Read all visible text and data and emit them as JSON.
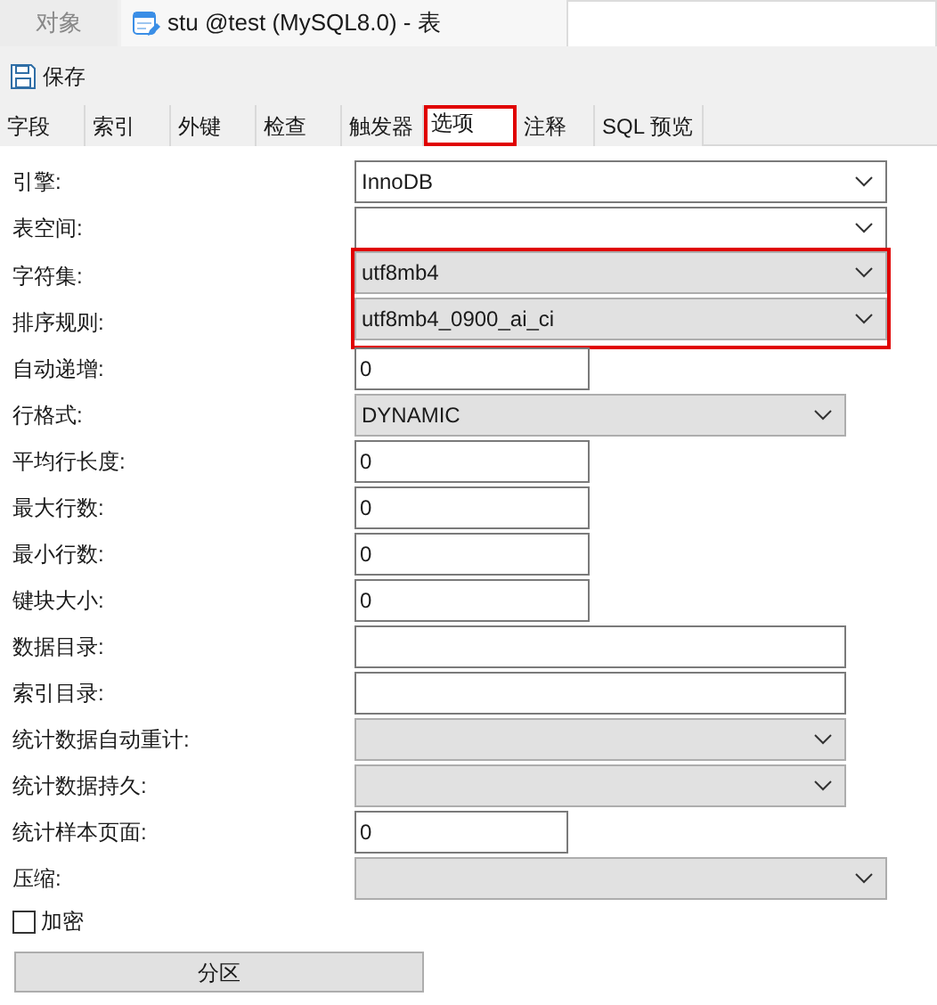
{
  "doc_tabs": [
    {
      "label": "对象",
      "selected": false,
      "icon": false
    },
    {
      "label": "stu @test (MySQL8.0) - 表",
      "selected": true,
      "icon": true
    }
  ],
  "toolbar": {
    "save": "保存"
  },
  "tabs": [
    {
      "label": "字段",
      "selected": false,
      "highlighted": false
    },
    {
      "label": "索引",
      "selected": false,
      "highlighted": false
    },
    {
      "label": "外键",
      "selected": false,
      "highlighted": false
    },
    {
      "label": "检查",
      "selected": false,
      "highlighted": false
    },
    {
      "label": "触发器",
      "selected": false,
      "highlighted": false
    },
    {
      "label": "选项",
      "selected": true,
      "highlighted": true
    },
    {
      "label": "注释",
      "selected": false,
      "highlighted": false
    },
    {
      "label": "SQL 预览",
      "selected": false,
      "highlighted": false
    }
  ],
  "fields": [
    {
      "label": "引擎:",
      "kind": "combo",
      "value": "InnoDB",
      "highlighted": false
    },
    {
      "label": "表空间:",
      "kind": "combo",
      "highlighted": false
    },
    {
      "label": "字符集:",
      "kind": "dropdown",
      "value": "utf8mb4",
      "highlighted": true
    },
    {
      "label": "排序规则:",
      "kind": "dropdown",
      "value": "utf8mb4_0900_ai_ci",
      "highlighted": true
    },
    {
      "label": "自动递增:",
      "kind": "text",
      "value": "0",
      "highlighted": false
    },
    {
      "label": "行格式:",
      "kind": "dropdown",
      "value": "DYNAMIC",
      "highlighted": false
    },
    {
      "label": "平均行长度:",
      "kind": "text",
      "value": "0",
      "highlighted": false
    },
    {
      "label": "最大行数:",
      "kind": "text",
      "value": "0",
      "highlighted": false
    },
    {
      "label": "最小行数:",
      "kind": "text",
      "value": "0",
      "highlighted": false
    },
    {
      "label": "键块大小:",
      "kind": "text",
      "value": "0",
      "highlighted": false
    },
    {
      "label": "数据目录:",
      "kind": "text",
      "highlighted": false
    },
    {
      "label": "索引目录:",
      "kind": "text",
      "highlighted": false
    },
    {
      "label": "统计数据自动重计:",
      "kind": "dropdown",
      "highlighted": false
    },
    {
      "label": "统计数据持久:",
      "kind": "dropdown",
      "highlighted": false
    },
    {
      "label": "统计样本页面:",
      "kind": "text",
      "value": "0",
      "highlighted": false
    },
    {
      "label": "压缩:",
      "kind": "dropdown",
      "highlighted": false
    }
  ],
  "encrypt": {
    "label": "加密",
    "checked": false
  },
  "partition_button": "分区"
}
